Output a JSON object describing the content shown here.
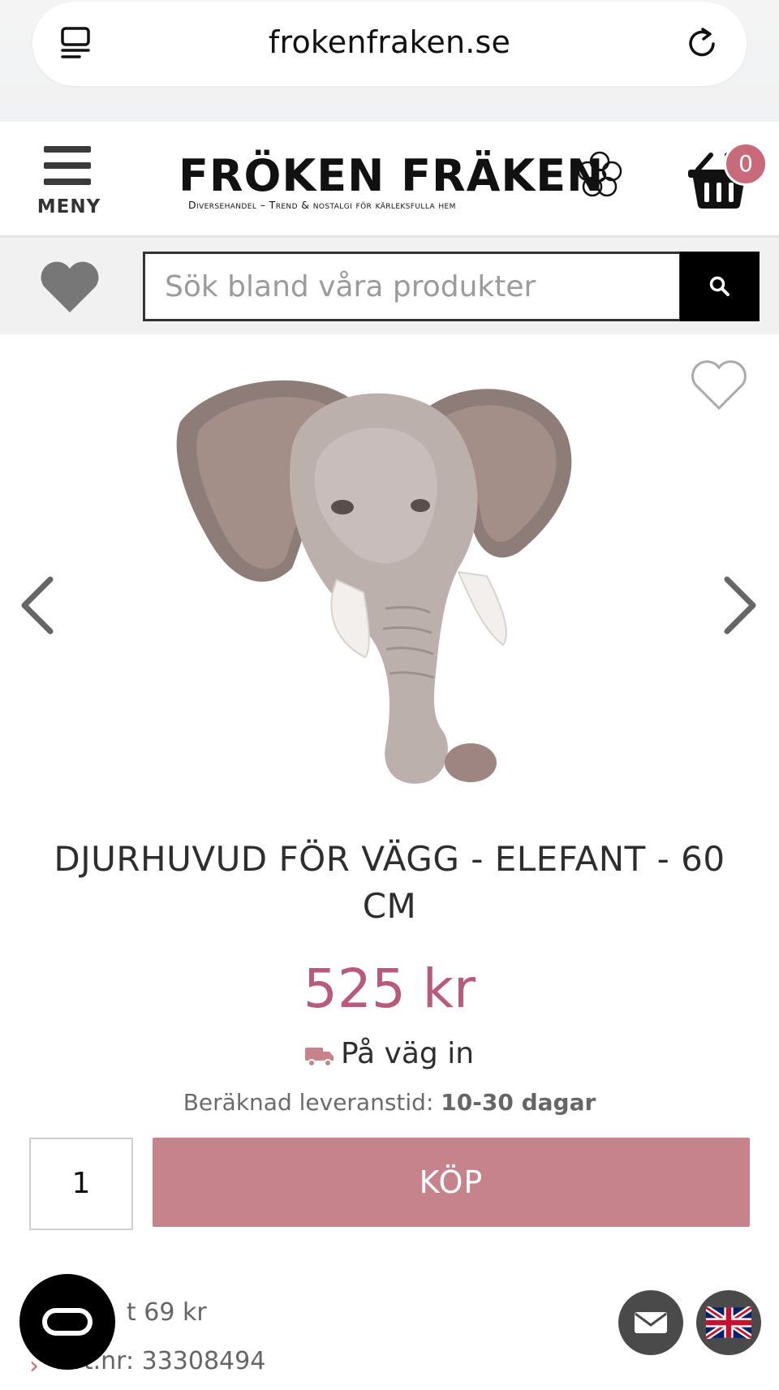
{
  "browser": {
    "url": "frokenfraken.se"
  },
  "header": {
    "menu_label": "MENY",
    "logo_text": "FRÖKEN FRÄKEN",
    "logo_tagline": "Diversehandel – Trend & nostalgi för kärleksfulla hem",
    "cart_count": "0"
  },
  "search": {
    "placeholder": "Sök bland våra produkter"
  },
  "product": {
    "title": "DJURHUVUD FÖR VÄGG - ELEFANT - 60 CM",
    "price": "525 kr",
    "stock_status": "På väg in",
    "delivery_label": "Beräknad leveranstid:",
    "delivery_value": "10-30 dagar",
    "quantity": "1",
    "buy_label": "KÖP",
    "shipping_text": "t 69 kr",
    "article_number": "Art.nr: 33308494"
  },
  "colors": {
    "accent": "#b85a7a",
    "buy_button": "#c7838c",
    "badge": "#c96a7b"
  }
}
